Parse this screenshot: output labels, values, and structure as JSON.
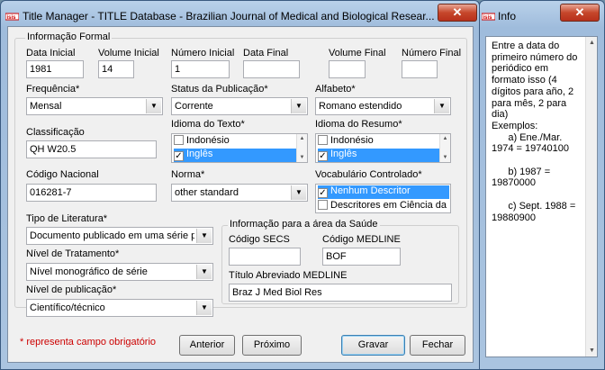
{
  "main_window": {
    "title": "Title Manager - TITLE Database - Brazilian Journal of Medical and Biological Resear...",
    "close_label": "✕"
  },
  "info_window": {
    "title": "Info",
    "close_label": "✕",
    "text": "Entre a data do\nprimeiro número do\nperiódico em\nformato isso (4\ndígitos para año, 2\npara mês, 2 para\ndia)\nExemplos:\n      a) Ene./Mar.\n1974 = 19740100\n\n      b) 1987 =\n19870000\n\n      c) Sept. 1988 =\n19880900"
  },
  "form": {
    "group_title": "Informação Formal",
    "data_inicial": {
      "label": "Data Inicial",
      "value": "1981"
    },
    "volume_inicial": {
      "label": "Volume Inicial",
      "value": "14"
    },
    "numero_inicial": {
      "label": "Número Inicial",
      "value": "1"
    },
    "data_final": {
      "label": "Data Final",
      "value": ""
    },
    "volume_final": {
      "label": "Volume Final",
      "value": ""
    },
    "numero_final": {
      "label": "Número Final",
      "value": ""
    },
    "frequencia": {
      "label": "Frequência*",
      "value": "Mensal"
    },
    "status": {
      "label": "Status da Publicação*",
      "value": "Corrente"
    },
    "alfabeto": {
      "label": "Alfabeto*",
      "value": "Romano estendido"
    },
    "classificacao": {
      "label": "Classificação",
      "value": "QH W20.5"
    },
    "idioma_texto": {
      "label": "Idioma do Texto*",
      "items": [
        {
          "label": "Indonésio",
          "checked": false,
          "selected": false
        },
        {
          "label": "Inglês",
          "checked": true,
          "selected": true
        }
      ]
    },
    "idioma_resumo": {
      "label": "Idioma do Resumo*",
      "items": [
        {
          "label": "Indonésio",
          "checked": false,
          "selected": false
        },
        {
          "label": "Inglês",
          "checked": true,
          "selected": true
        }
      ]
    },
    "codigo_nacional": {
      "label": "Código Nacional",
      "value": "016281-7"
    },
    "norma": {
      "label": "Norma*",
      "value": "other standard"
    },
    "vocabulario": {
      "label": "Vocabulário Controlado*",
      "items": [
        {
          "label": "Nenhum Descritor",
          "checked": true,
          "selected": true
        },
        {
          "label": "Descritores em Ciência da S",
          "checked": false,
          "selected": false
        }
      ]
    },
    "tipo_literatura": {
      "label": "Tipo de Literatura*",
      "value": "Documento publicado em uma série per"
    },
    "nivel_tratamento": {
      "label": "Nível de Tratamento*",
      "value": "Nível monográfico de série"
    },
    "nivel_publicacao": {
      "label": "Nível de publicação*",
      "value": "Científico/técnico"
    },
    "saude": {
      "group_title": "Informação para a área da Saúde",
      "codigo_secs": {
        "label": "Código SECS",
        "value": ""
      },
      "codigo_medline": {
        "label": "Código MEDLINE",
        "value": "BOF"
      },
      "titulo_abreviado": {
        "label": "Título Abreviado MEDLINE",
        "value": "Braz J Med Biol Res"
      }
    },
    "required_note": "* representa campo obrigatório"
  },
  "buttons": {
    "anterior": "Anterior",
    "proximo": "Próximo",
    "gravar": "Gravar",
    "fechar": "Fechar"
  },
  "colors": {
    "selection": "#3399ff",
    "required_note": "#cc0000",
    "close_button": "#c6472b"
  }
}
